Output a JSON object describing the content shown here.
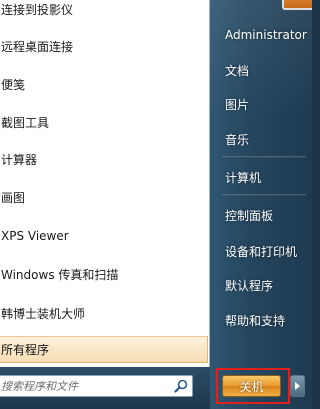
{
  "programs": [
    {
      "label": "连接到投影仪"
    },
    {
      "label": "远程桌面连接"
    },
    {
      "label": "便笺"
    },
    {
      "label": "截图工具"
    },
    {
      "label": "计算器"
    },
    {
      "label": "画图"
    },
    {
      "label": "XPS Viewer"
    },
    {
      "label": "Windows 传真和扫描"
    },
    {
      "label": "韩博士装机大师"
    }
  ],
  "all_programs": {
    "label": "所有程序"
  },
  "search": {
    "placeholder": "搜索程序和文件",
    "icon": "search-icon"
  },
  "right_pane": {
    "user": "Administrator",
    "items": [
      {
        "label": "文档"
      },
      {
        "label": "图片"
      },
      {
        "label": "音乐"
      },
      {
        "label": "计算机"
      },
      {
        "label": "控制面板"
      },
      {
        "label": "设备和打印机"
      },
      {
        "label": "默认程序"
      },
      {
        "label": "帮助和支持"
      }
    ]
  },
  "shutdown": {
    "label": "关机",
    "arrow_icon": "chevron-right-icon"
  },
  "colors": {
    "highlight_border": "#e0201c",
    "all_programs_bg": "#f7ddb4",
    "right_pane_bg": "#25465f",
    "shutdown_bg": "#e99a2c"
  }
}
